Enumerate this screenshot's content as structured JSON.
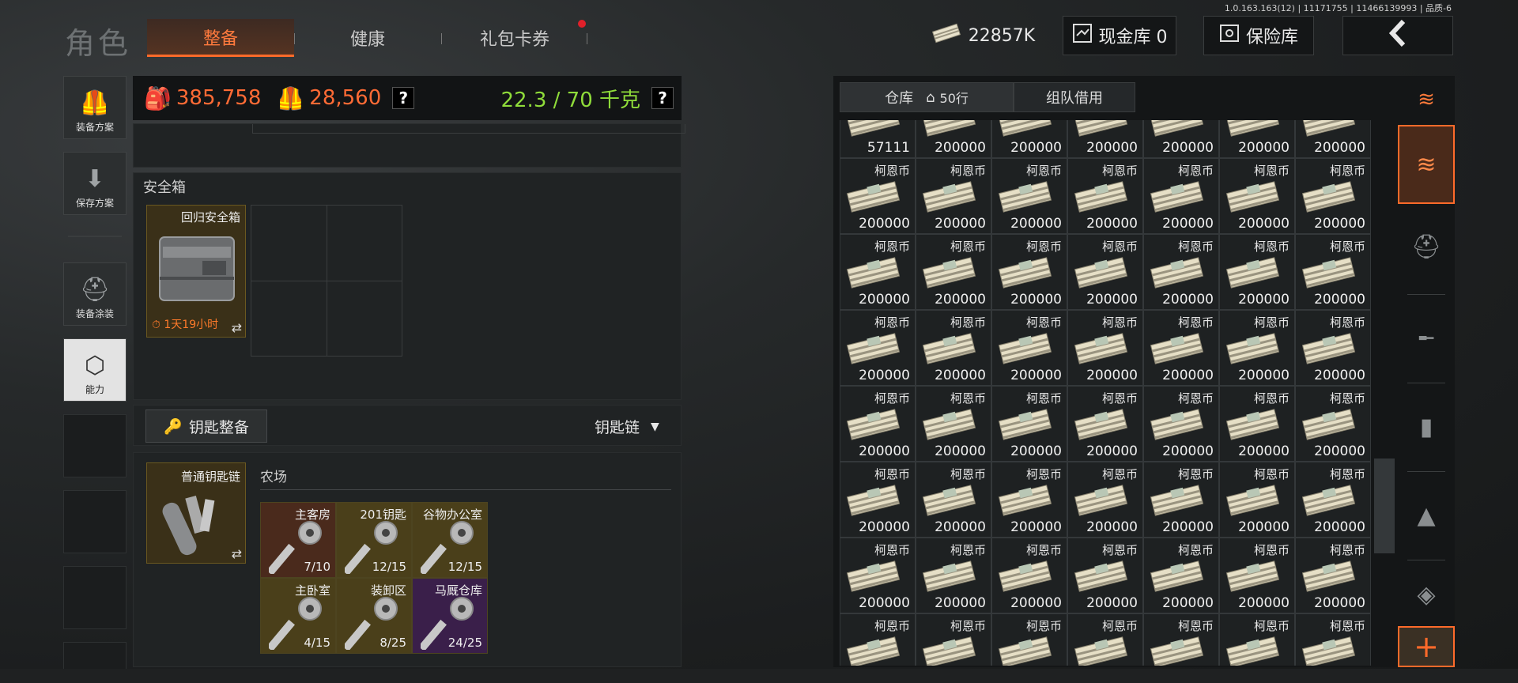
{
  "header": {
    "version_info": "1.0.163.163(12) | 11171755 | 11466139993 | 品质-6",
    "page_title": "角色",
    "tabs": [
      {
        "label": "整备",
        "active": true
      },
      {
        "label": "健康",
        "active": false
      },
      {
        "label": "礼包卡券",
        "active": false,
        "has_notification": true
      }
    ],
    "currency_value": "22857K",
    "cash_vault_label": "现金库 0",
    "safe_label": "保险库",
    "back_icon": "chevron-left-icon"
  },
  "left_menu": [
    {
      "label": "装备方案",
      "icon": "vest-icon",
      "active": false
    },
    {
      "label": "保存方案",
      "icon": "save-arrow-icon",
      "active": false
    },
    {
      "label": "装备涂装",
      "icon": "helmet-paint-icon",
      "active": false
    },
    {
      "label": "能力",
      "icon": "lightning-badge-icon",
      "active": true
    }
  ],
  "stats": {
    "backpack_value": "385,758",
    "armor_value": "28,560",
    "weight": "22.3 / 70 千克",
    "help_label": "?"
  },
  "safe_box": {
    "title": "安全箱",
    "item_name": "回归安全箱",
    "timer": "1天19小时"
  },
  "keys": {
    "button_label": "钥匙整备",
    "dropdown_label": "钥匙链",
    "keychain_name": "普通钥匙链",
    "area_title": "农场",
    "items": [
      {
        "name": "主客房",
        "count": "7/10",
        "color": "#4a2a1c"
      },
      {
        "name": "201钥匙",
        "count": "12/15",
        "color": "#4a3f1a"
      },
      {
        "name": "谷物办公室",
        "count": "12/15",
        "color": "#4a3f1a"
      },
      {
        "name": "主卧室",
        "count": "4/15",
        "color": "#4a3f1a"
      },
      {
        "name": "装卸区",
        "count": "8/25",
        "color": "#4a3f1a"
      },
      {
        "name": "马厩仓库",
        "count": "24/25",
        "color": "#3a1f4a"
      }
    ]
  },
  "stash": {
    "tab_warehouse": "仓库",
    "rows_label": "50行",
    "tab_team": "组队借用",
    "item_name": "柯恩币",
    "first_row": [
      "57111",
      "200000",
      "200000",
      "200000",
      "200000",
      "200000",
      "200000"
    ],
    "value": "200000"
  },
  "right_filters": [
    {
      "icon": "layers-refresh-icon",
      "active": false
    },
    {
      "icon": "layers-icon",
      "active": true
    },
    {
      "icon": "helmet-icon",
      "active": false
    },
    {
      "icon": "rifle-icon",
      "active": false
    },
    {
      "icon": "magazine-icon",
      "active": false
    },
    {
      "icon": "bullet-icon",
      "active": false
    },
    {
      "icon": "scope-icon",
      "active": false
    }
  ],
  "add_label": "+"
}
